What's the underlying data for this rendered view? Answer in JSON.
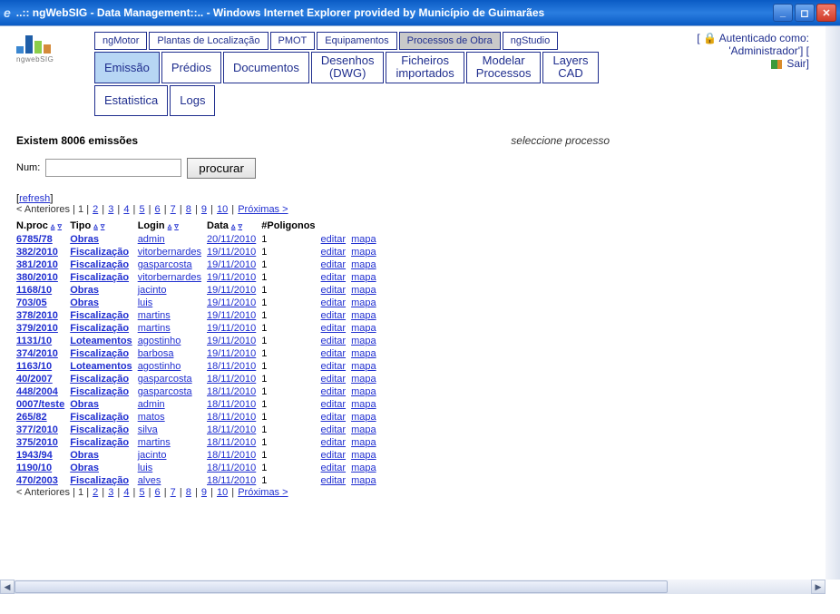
{
  "window_title": "..:: ngWebSIG - Data Management::.. - Windows Internet Explorer provided by Município de Guimarães",
  "logo_text": "ngwebSIG",
  "top_tabs": [
    "ngMotor",
    "Plantas de Localização",
    "PMOT",
    "Equipamentos",
    "Processos de Obra",
    "ngStudio"
  ],
  "top_tabs_active_index": 4,
  "sub_tabs": [
    {
      "label": "Emissão"
    },
    {
      "label": "Prédios"
    },
    {
      "label": "Documentos"
    },
    {
      "label": "Desenhos (DWG)"
    },
    {
      "label": "Ficheiros importados"
    },
    {
      "label": "Modelar Processos"
    },
    {
      "label": "Layers CAD"
    },
    {
      "label": "Estatistica"
    },
    {
      "label": "Logs"
    }
  ],
  "sub_tabs_active_index": 0,
  "auth": {
    "line1": "Autenticado como:",
    "line2": "'Administrador'] [",
    "sair": "Sair]"
  },
  "summary": "Existem 8006 emissões",
  "select_proc": "seleccione processo",
  "search": {
    "label": "Num:",
    "button": "procurar",
    "value": ""
  },
  "refresh": "refresh",
  "pager": {
    "prev": "< Anteriores",
    "pages": [
      "1",
      "2",
      "3",
      "4",
      "5",
      "6",
      "7",
      "8",
      "9",
      "10"
    ],
    "next": "Próximas >",
    "current_index": 0
  },
  "columns": {
    "nproc": "N.proc",
    "tipo": "Tipo",
    "login": "Login",
    "data": "Data",
    "poligonos": "#Poligonos"
  },
  "actions": {
    "editar": "editar",
    "mapa": "mapa"
  },
  "rows": [
    {
      "nproc": "6785/78",
      "tipo": "Obras",
      "login": "admin",
      "data": "20/11/2010",
      "pol": "1"
    },
    {
      "nproc": "382/2010",
      "tipo": "Fiscalização",
      "login": "vitorbernardes",
      "data": "19/11/2010",
      "pol": "1"
    },
    {
      "nproc": "381/2010",
      "tipo": "Fiscalização",
      "login": "gasparcosta",
      "data": "19/11/2010",
      "pol": "1"
    },
    {
      "nproc": "380/2010",
      "tipo": "Fiscalização",
      "login": "vitorbernardes",
      "data": "19/11/2010",
      "pol": "1"
    },
    {
      "nproc": "1168/10",
      "tipo": "Obras",
      "login": "jacinto",
      "data": "19/11/2010",
      "pol": "1"
    },
    {
      "nproc": "703/05",
      "tipo": "Obras",
      "login": "luis",
      "data": "19/11/2010",
      "pol": "1"
    },
    {
      "nproc": "378/2010",
      "tipo": "Fiscalização",
      "login": "martins",
      "data": "19/11/2010",
      "pol": "1"
    },
    {
      "nproc": "379/2010",
      "tipo": "Fiscalização",
      "login": "martins",
      "data": "19/11/2010",
      "pol": "1"
    },
    {
      "nproc": "1131/10",
      "tipo": "Loteamentos",
      "login": "agostinho",
      "data": "19/11/2010",
      "pol": "1"
    },
    {
      "nproc": "374/2010",
      "tipo": "Fiscalização",
      "login": "barbosa",
      "data": "19/11/2010",
      "pol": "1"
    },
    {
      "nproc": "1163/10",
      "tipo": "Loteamentos",
      "login": "agostinho",
      "data": "18/11/2010",
      "pol": "1"
    },
    {
      "nproc": "40/2007",
      "tipo": "Fiscalização",
      "login": "gasparcosta",
      "data": "18/11/2010",
      "pol": "1"
    },
    {
      "nproc": "448/2004",
      "tipo": "Fiscalização",
      "login": "gasparcosta",
      "data": "18/11/2010",
      "pol": "1"
    },
    {
      "nproc": "0007/teste",
      "tipo": "Obras",
      "login": "admin",
      "data": "18/11/2010",
      "pol": "1"
    },
    {
      "nproc": "265/82",
      "tipo": "Fiscalização",
      "login": "matos",
      "data": "18/11/2010",
      "pol": "1"
    },
    {
      "nproc": "377/2010",
      "tipo": "Fiscalização",
      "login": "silva",
      "data": "18/11/2010",
      "pol": "1"
    },
    {
      "nproc": "375/2010",
      "tipo": "Fiscalização",
      "login": "martins",
      "data": "18/11/2010",
      "pol": "1"
    },
    {
      "nproc": "1943/94",
      "tipo": "Obras",
      "login": "jacinto",
      "data": "18/11/2010",
      "pol": "1"
    },
    {
      "nproc": "1190/10",
      "tipo": "Obras",
      "login": "luis",
      "data": "18/11/2010",
      "pol": "1"
    },
    {
      "nproc": "470/2003",
      "tipo": "Fiscalização",
      "login": "alves",
      "data": "18/11/2010",
      "pol": "1"
    }
  ]
}
